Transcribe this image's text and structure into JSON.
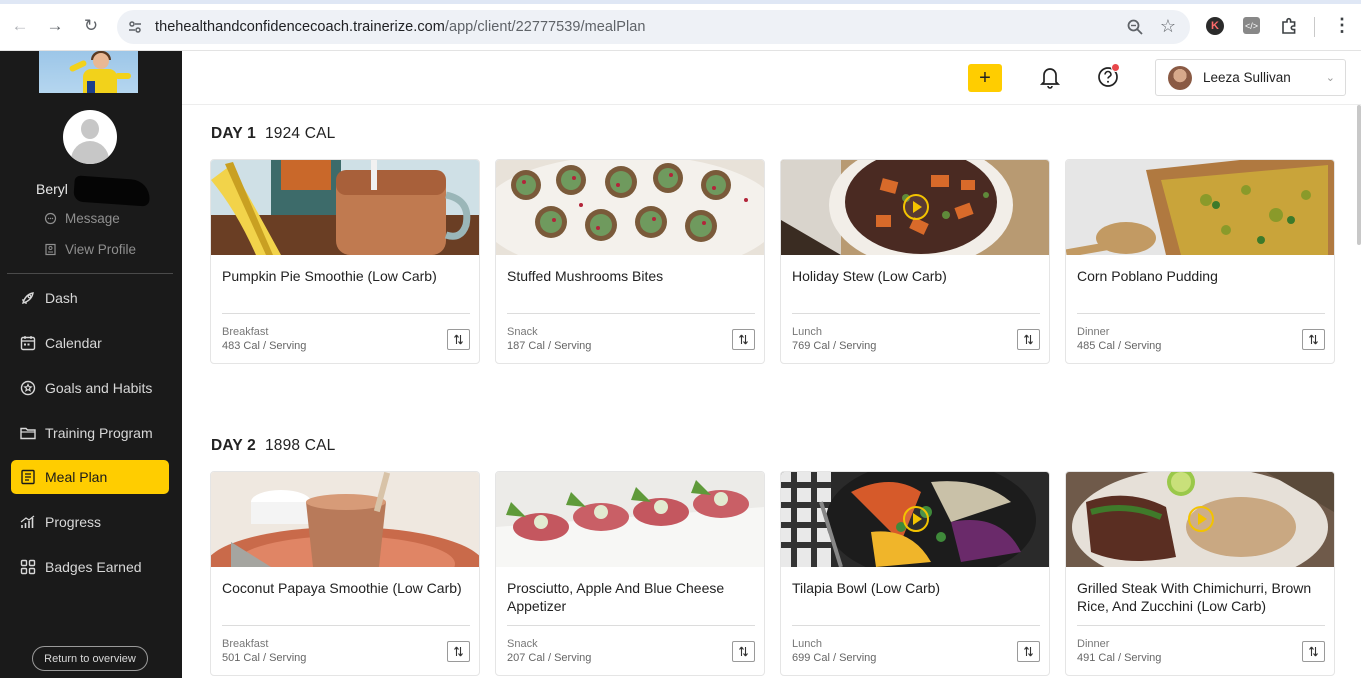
{
  "browser": {
    "url_host": "thehealthandconfidencecoach.trainerize.com",
    "url_path": "/app/client/22777539/mealPlan"
  },
  "sidebar": {
    "client_name": "Beryl",
    "links": [
      {
        "label": "Message",
        "icon": "chat-bubble-icon"
      },
      {
        "label": "View Profile",
        "icon": "profile-card-icon"
      }
    ],
    "nav": [
      {
        "label": "Dash",
        "icon": "rocket-icon",
        "active": false
      },
      {
        "label": "Calendar",
        "icon": "calendar-icon",
        "active": false
      },
      {
        "label": "Goals and Habits",
        "icon": "goals-icon",
        "active": false
      },
      {
        "label": "Training Program",
        "icon": "folder-icon",
        "active": false
      },
      {
        "label": "Meal Plan",
        "icon": "meal-plan-icon",
        "active": true
      },
      {
        "label": "Progress",
        "icon": "progress-chart-icon",
        "active": false
      },
      {
        "label": "Badges Earned",
        "icon": "badges-grid-icon",
        "active": false
      }
    ],
    "return_label": "Return to overview"
  },
  "header": {
    "user_name": "Leeza Sullivan",
    "accent_color": "#ffcd00",
    "notification_dot_color": "#e8474a"
  },
  "days": [
    {
      "day": "DAY 1",
      "cal": "1924 CAL",
      "meals": [
        {
          "title": "Pumpkin Pie Smoothie (Low Carb)",
          "type": "Breakfast",
          "cal": "483 Cal / Serving",
          "video": false
        },
        {
          "title": "Stuffed Mushrooms Bites",
          "type": "Snack",
          "cal": "187 Cal / Serving",
          "video": false
        },
        {
          "title": "Holiday Stew (Low Carb)",
          "type": "Lunch",
          "cal": "769 Cal / Serving",
          "video": true
        },
        {
          "title": "Corn Poblano Pudding",
          "type": "Dinner",
          "cal": "485 Cal / Serving",
          "video": false
        }
      ]
    },
    {
      "day": "DAY 2",
      "cal": "1898 CAL",
      "meals": [
        {
          "title": "Coconut Papaya Smoothie (Low Carb)",
          "type": "Breakfast",
          "cal": "501 Cal / Serving",
          "video": false
        },
        {
          "title": "Prosciutto, Apple And Blue Cheese Appetizer",
          "type": "Snack",
          "cal": "207 Cal / Serving",
          "video": false
        },
        {
          "title": "Tilapia Bowl (Low Carb)",
          "type": "Lunch",
          "cal": "699 Cal / Serving",
          "video": true
        },
        {
          "title": "Grilled Steak With Chimichurri, Brown Rice, And Zucchini (Low Carb)",
          "type": "Dinner",
          "cal": "491 Cal / Serving",
          "video": true
        }
      ]
    }
  ]
}
